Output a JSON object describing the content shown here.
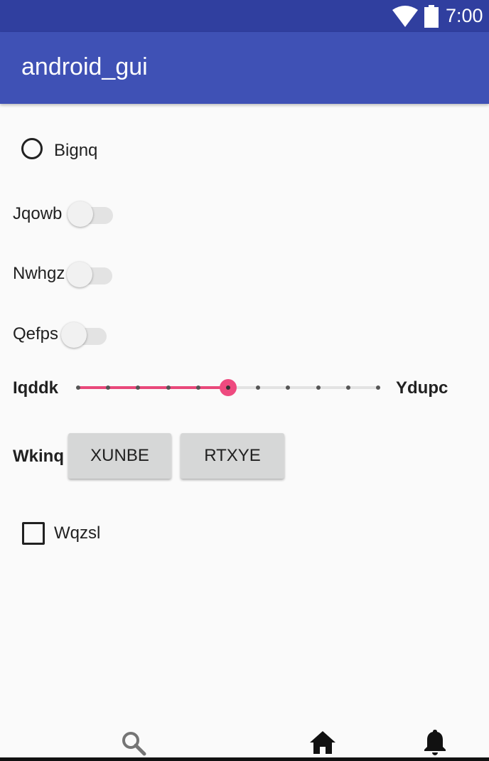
{
  "status_bar": {
    "time": "7:00",
    "icons": [
      "wifi-icon",
      "battery-icon"
    ]
  },
  "app_bar": {
    "title": "android_gui"
  },
  "content": {
    "radio": {
      "label": "Bignq",
      "checked": false
    },
    "switches": [
      {
        "label": "Jqowb",
        "on": false
      },
      {
        "label": "Nwhgz",
        "on": false
      },
      {
        "label": "Qefps",
        "on": false
      }
    ],
    "slider": {
      "min_label": "Iqddk",
      "max_label": "Ydupc",
      "value_fraction": 0.5,
      "steps": 10,
      "accent_color": "#e9487a"
    },
    "button_row": {
      "label": "Wkinq",
      "buttons": [
        "XUNBE",
        "RTXYE"
      ]
    },
    "checkbox": {
      "label": "Wqzsl",
      "checked": false
    }
  },
  "bottom_nav": {
    "items": [
      "search-icon",
      "home-icon",
      "bell-icon"
    ]
  },
  "colors": {
    "status_bar": "#303f9f",
    "app_bar": "#3f51b5",
    "background": "#fafafa"
  }
}
